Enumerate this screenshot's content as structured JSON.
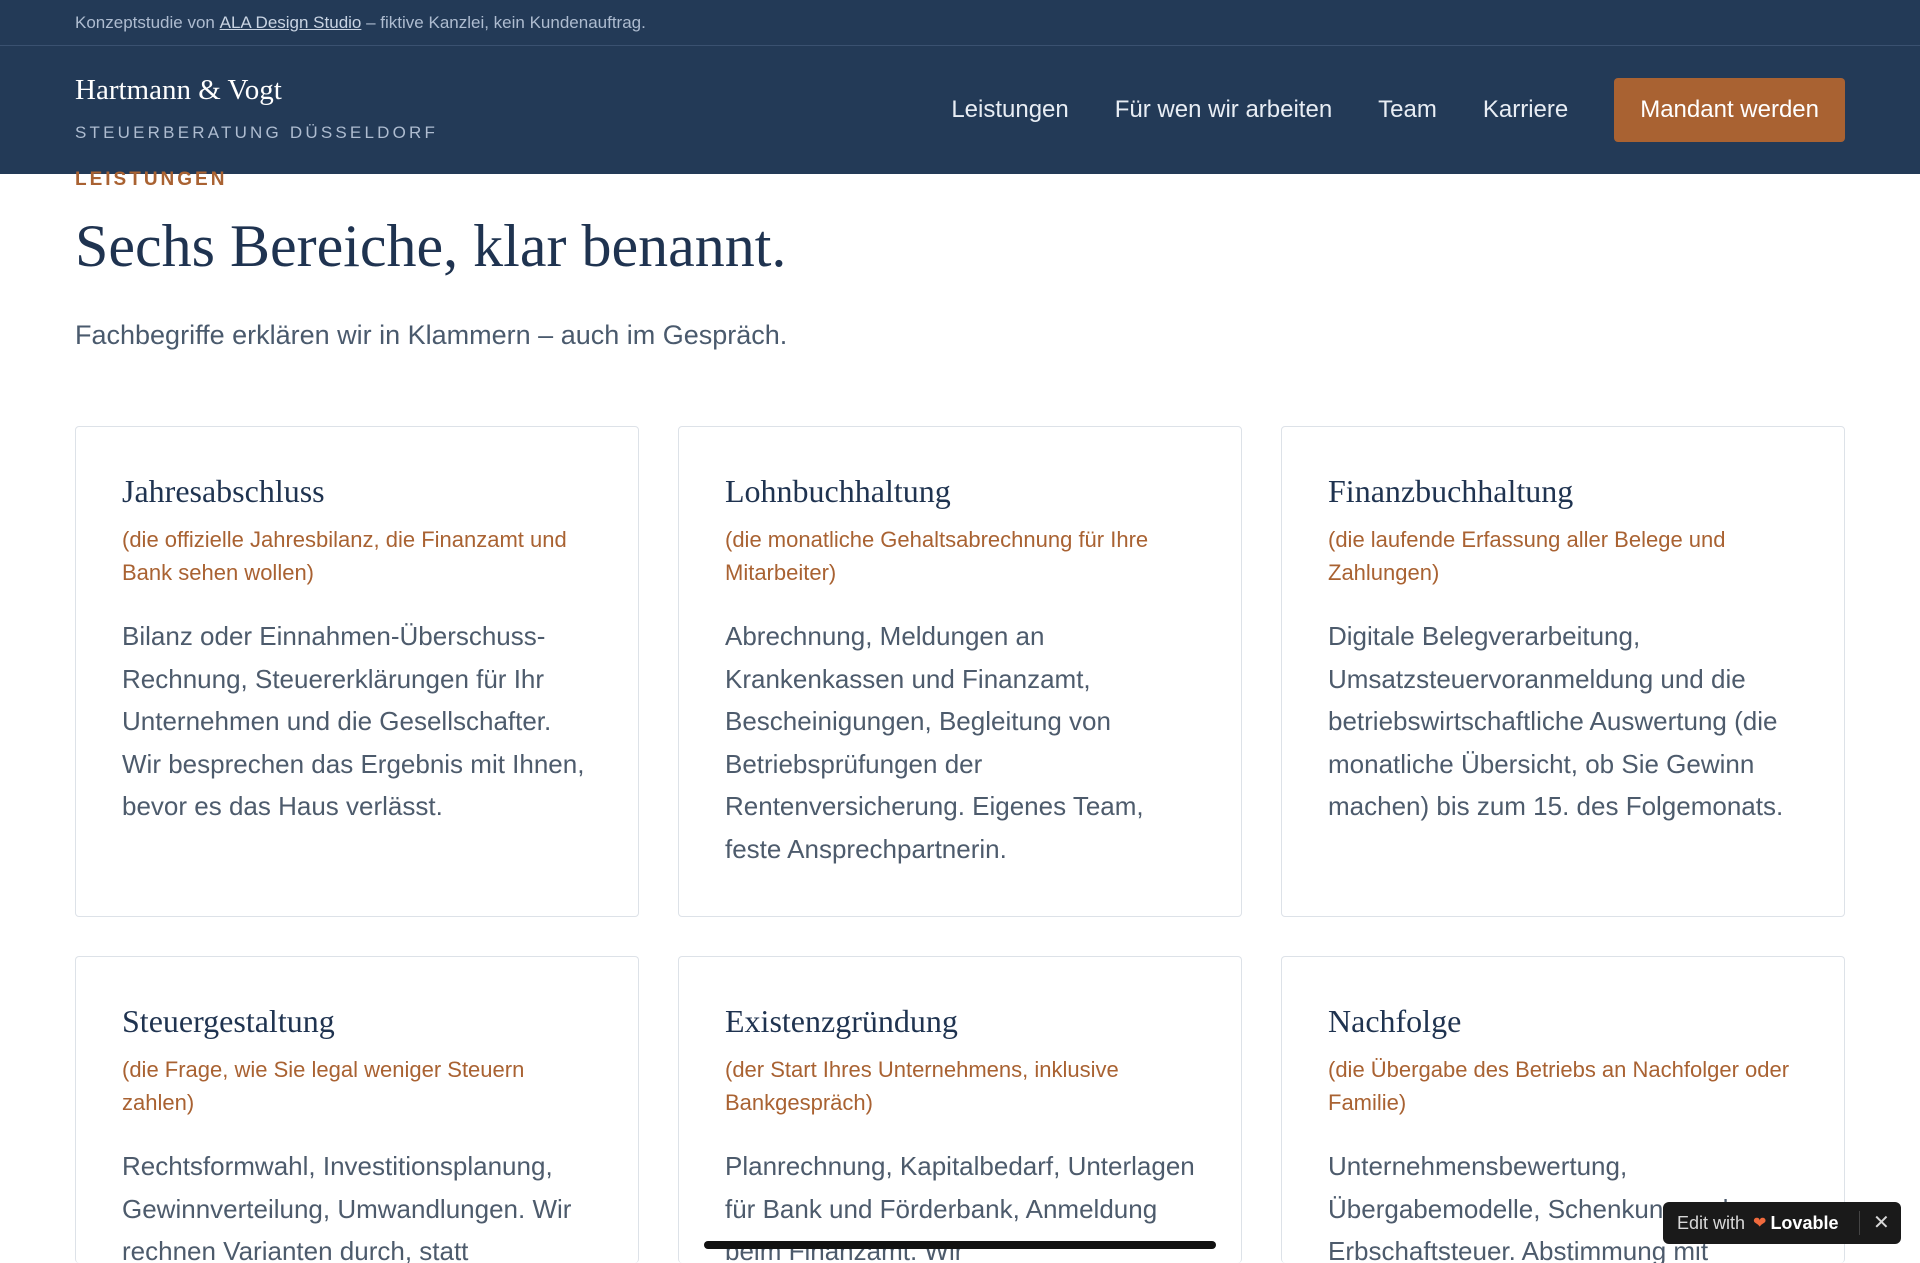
{
  "topbar": {
    "prefix": "Konzeptstudie von",
    "link": "ALA Design Studio",
    "suffix": "– fiktive Kanzlei, kein Kundenauftrag."
  },
  "brand": {
    "name": "Hartmann & Vogt",
    "subtitle": "STEUERBERATUNG DÜSSELDORF"
  },
  "nav": {
    "items": [
      "Leistungen",
      "Für wen wir arbeiten",
      "Team",
      "Karriere"
    ],
    "cta": "Mandant werden"
  },
  "section": {
    "eyebrow": "LEISTUNGEN",
    "title": "Sechs Bereiche, klar benannt.",
    "intro": "Fachbegriffe erklären wir in Klammern – auch im Gespräch."
  },
  "cards": [
    {
      "title": "Jahresabschluss",
      "gloss": "(die offizielle Jahresbilanz, die Finanzamt und Bank sehen wollen)",
      "body": "Bilanz oder Einnahmen-Überschuss-Rechnung, Steuererklärungen für Ihr Unternehmen und die Gesellschafter. Wir besprechen das Ergebnis mit Ihnen, bevor es das Haus verlässt."
    },
    {
      "title": "Lohnbuchhaltung",
      "gloss": "(die monatliche Gehaltsabrechnung für Ihre Mitarbeiter)",
      "body": "Abrechnung, Meldungen an Krankenkassen und Finanzamt, Bescheinigungen, Begleitung von Betriebsprüfungen der Rentenversicherung. Eigenes Team, feste Ansprechpartnerin."
    },
    {
      "title": "Finanzbuchhaltung",
      "gloss": "(die laufende Erfassung aller Belege und Zahlungen)",
      "body": "Digitale Belegverarbeitung, Umsatzsteuervoranmeldung und die betriebswirtschaftliche Auswertung (die monatliche Übersicht, ob Sie Gewinn machen) bis zum 15. des Folgemonats."
    },
    {
      "title": "Steuergestaltung",
      "gloss": "(die Frage, wie Sie legal weniger Steuern zahlen)",
      "body": "Rechtsformwahl, Investitionsplanung, Gewinnverteilung, Umwandlungen. Wir rechnen Varianten durch, statt"
    },
    {
      "title": "Existenzgründung",
      "gloss": "(der Start Ihres Unternehmens, inklusive Bankgespräch)",
      "body": "Planrechnung, Kapitalbedarf, Unterlagen für Bank und Förderbank, Anmeldung beim Finanzamt. Wir"
    },
    {
      "title": "Nachfolge",
      "gloss": "(die Übergabe des Betriebs an Nachfolger oder Familie)",
      "body": "Unternehmensbewertung, Übergabemodelle, Schenkung und Erbschaftsteuer. Abstimmung mit"
    }
  ],
  "badge": {
    "label": "Edit with",
    "brand": "Lovable"
  }
}
